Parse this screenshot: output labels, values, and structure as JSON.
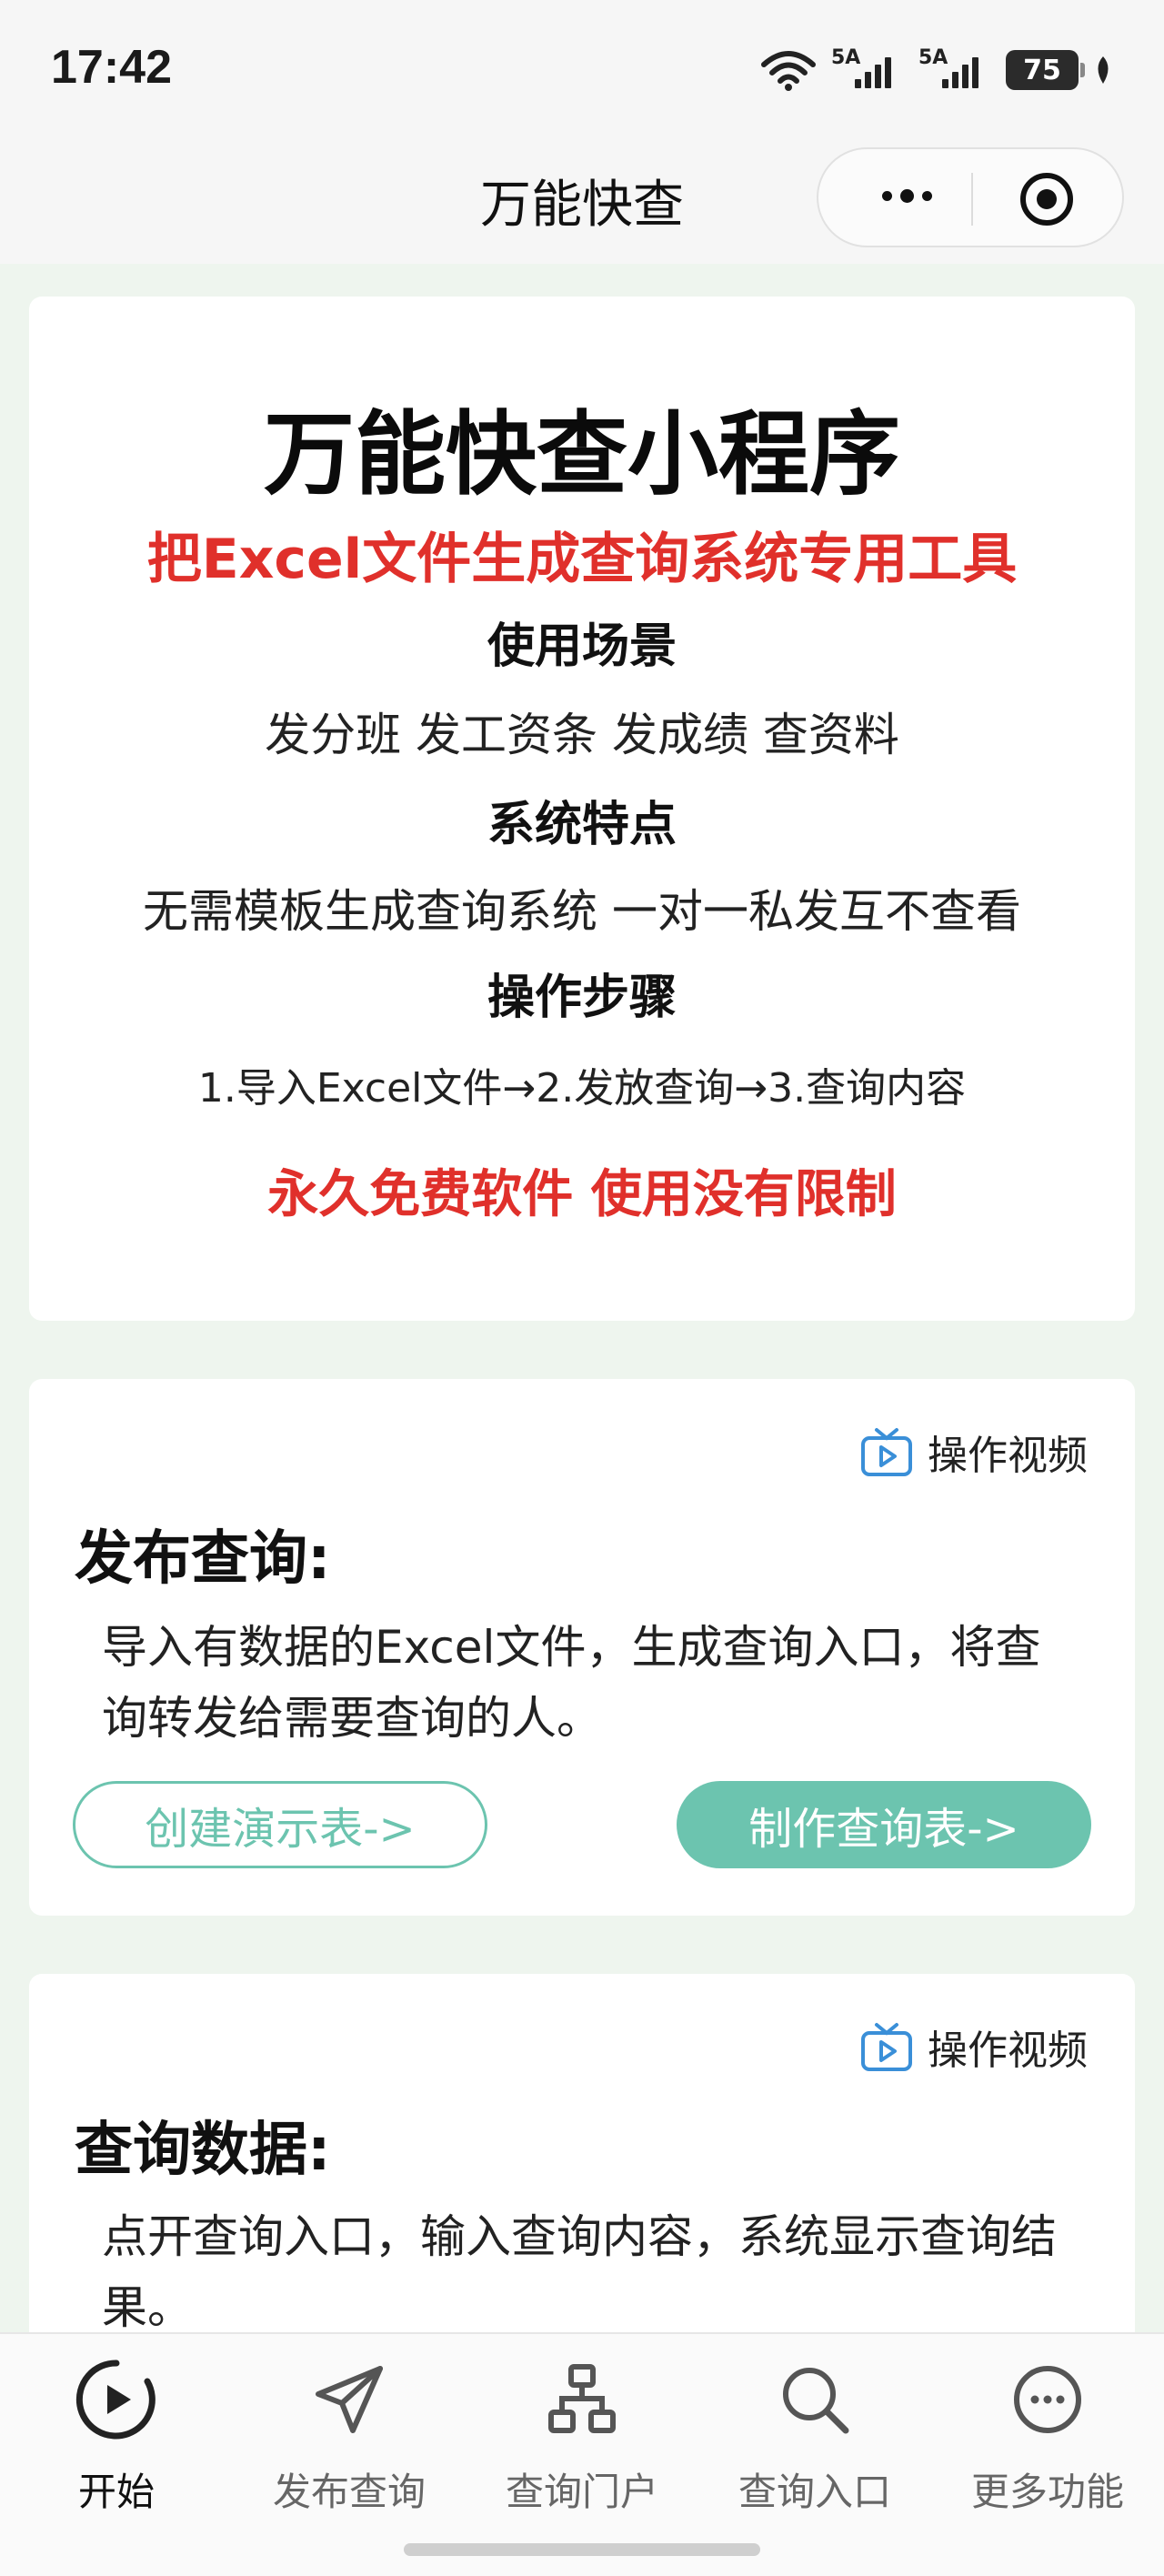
{
  "status_bar": {
    "time": "17:42",
    "signal1": "5A",
    "signal2": "5A",
    "battery": "75"
  },
  "navbar": {
    "title": "万能快查"
  },
  "intro": {
    "title": "万能快查小程序",
    "subtitle": "把Excel文件生成查询系统专用工具",
    "scene_heading": "使用场景",
    "scene_text": "发分班 发工资条 发成绩 查资料",
    "feature_heading": "系统特点",
    "feature_text": "无需模板生成查询系统 一对一私发互不查看",
    "steps_heading": "操作步骤",
    "steps_text": "1.导入Excel文件→2.发放查询→3.查询内容",
    "free_text": "永久免费软件 使用没有限制"
  },
  "publish": {
    "video_label": "操作视频",
    "title": "发布查询:",
    "desc": "导入有数据的Excel文件，生成查询入口，将查询转发给需要查询的人。",
    "demo_button": "创建演示表->",
    "make_button": "制作查询表->"
  },
  "query": {
    "video_label": "操作视频",
    "title": "查询数据:",
    "desc": "点开查询入口，输入查询内容，系统显示查询结果。"
  },
  "tabbar": {
    "tabs": [
      {
        "label": "开始",
        "icon": "play-icon",
        "active": true
      },
      {
        "label": "发布查询",
        "icon": "send-icon"
      },
      {
        "label": "查询门户",
        "icon": "sitemap-icon"
      },
      {
        "label": "查询入口",
        "icon": "search-icon"
      },
      {
        "label": "更多功能",
        "icon": "more-icon"
      }
    ]
  },
  "colors": {
    "accent": "#6cc4af",
    "highlight_red": "#e0302b",
    "page_bg": "#eef5ee"
  }
}
